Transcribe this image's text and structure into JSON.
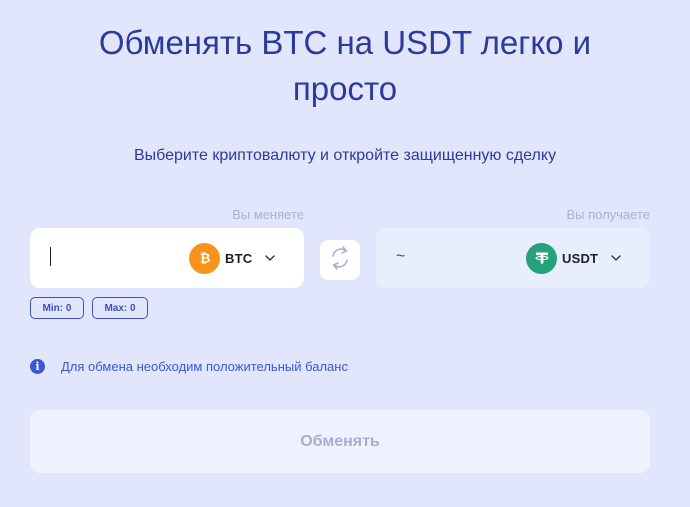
{
  "header": {
    "title_line1": "Обменять BTC на USDT легко и",
    "title_line2": "просто",
    "subtitle": "Выберите криптовалюту и откройте защищенную сделку"
  },
  "exchange": {
    "give": {
      "label": "Вы меняете",
      "amount": "",
      "currency": "BTC",
      "coin_color": "#f7931a"
    },
    "get": {
      "label": "Вы получаете",
      "amount_text": "~",
      "currency": "USDT",
      "coin_color": "#26a17b"
    },
    "limits": {
      "min_label": "Min: 0",
      "max_label": "Max: 0"
    }
  },
  "notice": {
    "text": "Для обмена необходим положительный баланс"
  },
  "submit": {
    "label": "Обменять",
    "enabled": false
  },
  "icons": {
    "give_coin": "bitcoin-icon",
    "get_coin": "tether-icon",
    "swap": "swap-arrows-icon",
    "dropdown": "chevron-down-icon",
    "info": "info-icon"
  },
  "colors": {
    "background": "#e1e6fd",
    "heading": "#2b3a9c",
    "accent": "#3a57d6",
    "disabled_text": "#a7aed3"
  }
}
